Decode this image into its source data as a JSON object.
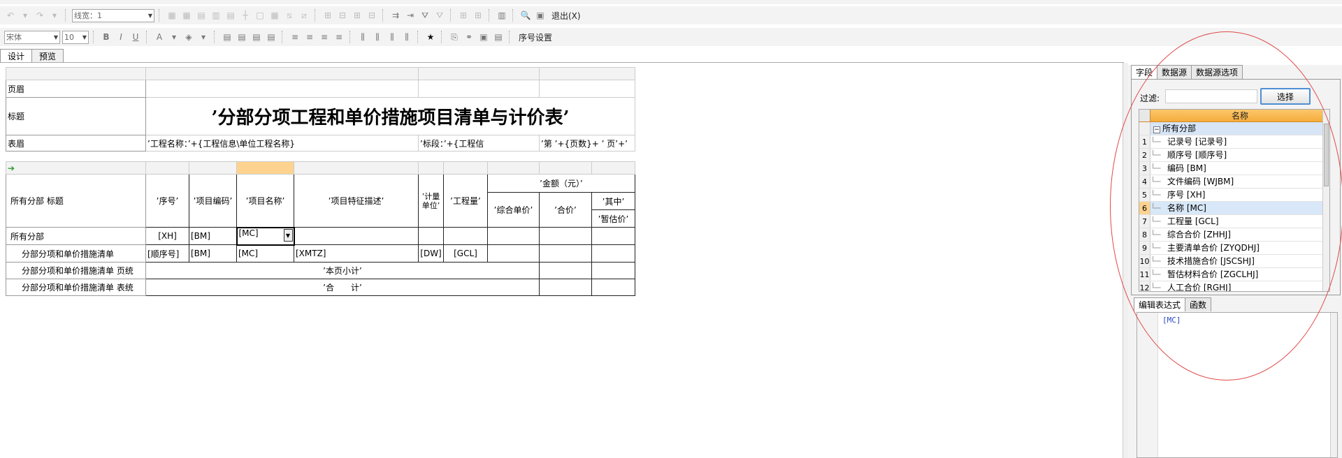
{
  "toolbar1": {
    "line_width": "线宽：1",
    "exit_label": "退出(X)"
  },
  "toolbar2": {
    "font_family": "宋体",
    "font_size": "10",
    "seq_settings": "序号设置"
  },
  "top_tabs": [
    {
      "label": "设计"
    },
    {
      "label": "预览"
    }
  ],
  "report": {
    "page_header": "页眉",
    "title_label": "标题",
    "table_header": "表眉",
    "title_text": "’分部分项工程和单价措施项目清单与计价表’",
    "proj_name_expr": "’工程名称：’+{工程信息\\单位工程名称}",
    "section_expr": "’标段：’+{工程信",
    "page_expr": "’第 ’+{页数}+ ’ 页’+’",
    "title_row_label": "所有分部 标题",
    "headers": {
      "seq": "’序号’",
      "code": "’项目编码’",
      "name": "’项目名称’",
      "feature": "’项目特征描述’",
      "unit": "’计量单位’",
      "qty": "’工程量’",
      "amount": "’金额（元）’",
      "unit_price": "’综合单价’",
      "total": "’合价’",
      "among": "’其中’",
      "est": "’暂估价’"
    },
    "group_row": {
      "label": "所有分部",
      "seq": "[XH]",
      "code": "[BM]",
      "name": "[MC]"
    },
    "detail_row": {
      "label": "分部分项和单价措施清单",
      "seq": "[顺序号]",
      "code": "[BM]",
      "name": "[MC]",
      "feature": "[XMTZ]",
      "unit": "[DW]",
      "qty": "[GCL]"
    },
    "page_total_row": {
      "label": "分部分项和单价措施清单 页统",
      "value": "’本页小计’"
    },
    "table_total_row": {
      "label": "分部分项和单价措施清单 表统",
      "value": "’合　　计’"
    }
  },
  "right_panel": {
    "tabs": [
      {
        "label": "字段"
      },
      {
        "label": "数据源"
      },
      {
        "label": "数据源选项"
      }
    ],
    "filter_label": "过滤:",
    "select_button": "选择",
    "grid_header": "名称",
    "group_row": "所有分部",
    "rows": [
      {
        "n": "1",
        "name": "记录号 [记录号]"
      },
      {
        "n": "2",
        "name": "顺序号 [顺序号]"
      },
      {
        "n": "3",
        "name": "编码 [BM]"
      },
      {
        "n": "4",
        "name": "文件编码 [WJBM]"
      },
      {
        "n": "5",
        "name": "序号 [XH]"
      },
      {
        "n": "6",
        "name": "名称 [MC]"
      },
      {
        "n": "7",
        "name": "工程量 [GCL]"
      },
      {
        "n": "8",
        "name": "综合合价 [ZHHJ]"
      },
      {
        "n": "9",
        "name": "主要清单合价 [ZYQDHJ]"
      },
      {
        "n": "10",
        "name": "技术措施合价 [JSCSHJ]"
      },
      {
        "n": "11",
        "name": "暂估材料合价 [ZGCLHJ]"
      },
      {
        "n": "12",
        "name": "人工合价 [RGHJ]"
      }
    ],
    "bottom_tabs": [
      {
        "label": "编辑表达式"
      },
      {
        "label": "函数"
      }
    ],
    "expression": "[MC]"
  },
  "colors": {
    "selection": "#fdd38f",
    "accent": "#4d8fd6",
    "annotation": "#e04848"
  }
}
